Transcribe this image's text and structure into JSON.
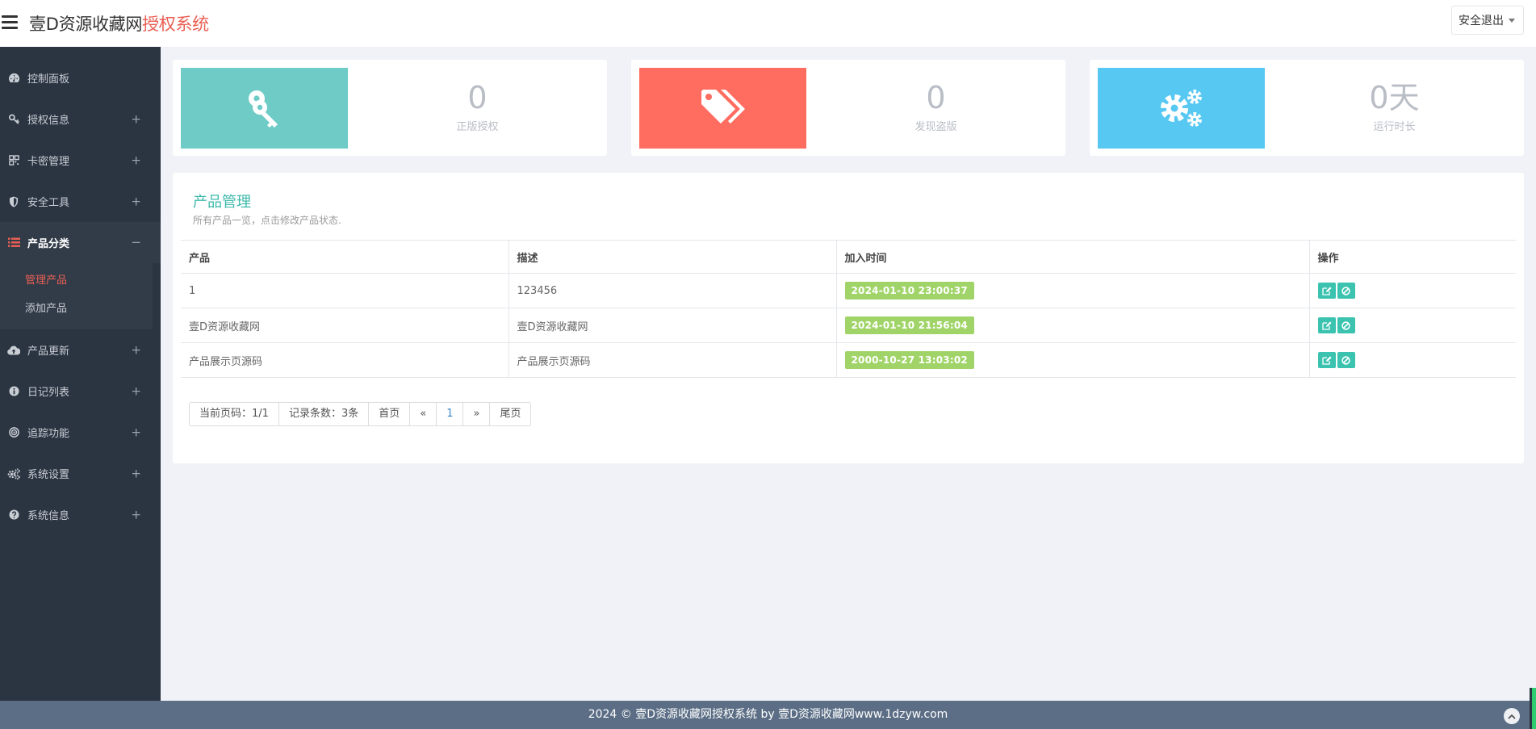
{
  "header": {
    "brand_part1": "壹D资源收藏网",
    "brand_part2": "授权系统",
    "logout_label": "安全退出"
  },
  "sidebar": {
    "items": [
      {
        "label": "控制面板",
        "icon": "dashboard-icon",
        "expandable": false
      },
      {
        "label": "授权信息",
        "icon": "key-icon",
        "expandable": true
      },
      {
        "label": "卡密管理",
        "icon": "qrcode-icon",
        "expandable": true
      },
      {
        "label": "安全工具",
        "icon": "shield-icon",
        "expandable": true
      },
      {
        "label": "产品分类",
        "icon": "list-icon",
        "expandable": true,
        "expanded": true
      },
      {
        "label": "产品更新",
        "icon": "cloud-upload-icon",
        "expandable": true
      },
      {
        "label": "日记列表",
        "icon": "info-icon",
        "expandable": true
      },
      {
        "label": "追踪功能",
        "icon": "target-icon",
        "expandable": true
      },
      {
        "label": "系统设置",
        "icon": "gears-icon",
        "expandable": true
      },
      {
        "label": "系统信息",
        "icon": "question-icon",
        "expandable": true
      }
    ],
    "submenu": [
      {
        "label": "管理产品",
        "current": true
      },
      {
        "label": "添加产品",
        "current": false
      }
    ]
  },
  "stats": [
    {
      "value": "0",
      "label": "正版授权",
      "color": "#6ecbc6",
      "icon": "key-icon"
    },
    {
      "value": "0",
      "label": "发现盗版",
      "color": "#ff6c60",
      "icon": "tags-icon"
    },
    {
      "value": "0天",
      "label": "运行时长",
      "color": "#57c8f2",
      "icon": "gears-icon"
    }
  ],
  "panel": {
    "title": "产品管理",
    "subtitle": "所有产品一览，点击修改产品状态.",
    "columns": [
      "产品",
      "描述",
      "加入时间",
      "操作"
    ],
    "rows": [
      {
        "product": "1",
        "description": "123456",
        "added": "2024-01-10 23:00:37"
      },
      {
        "product": "壹D资源收藏网",
        "description": "壹D资源收藏网",
        "added": "2024-01-10 21:56:04"
      },
      {
        "product": "产品展示页源码",
        "description": "产品展示页源码",
        "added": "2000-10-27 13:03:02"
      }
    ]
  },
  "pagination": {
    "current_page": "当前页码：1/1",
    "record_count": "记录条数：3条",
    "first": "首页",
    "prev": "«",
    "page": "1",
    "next": "»",
    "last": "尾页"
  },
  "footer": {
    "text": "2024 © 壹D资源收藏网授权系统 by 壹D资源收藏网www.1dzyw.com"
  },
  "colors": {
    "sidebar_bg": "#2b3542",
    "accent_red": "#e95f53",
    "accent_teal": "#3bb9ab",
    "badge_green": "#a0d468",
    "action_teal": "#3bc3b0",
    "footer_bg": "#5b6e85"
  }
}
